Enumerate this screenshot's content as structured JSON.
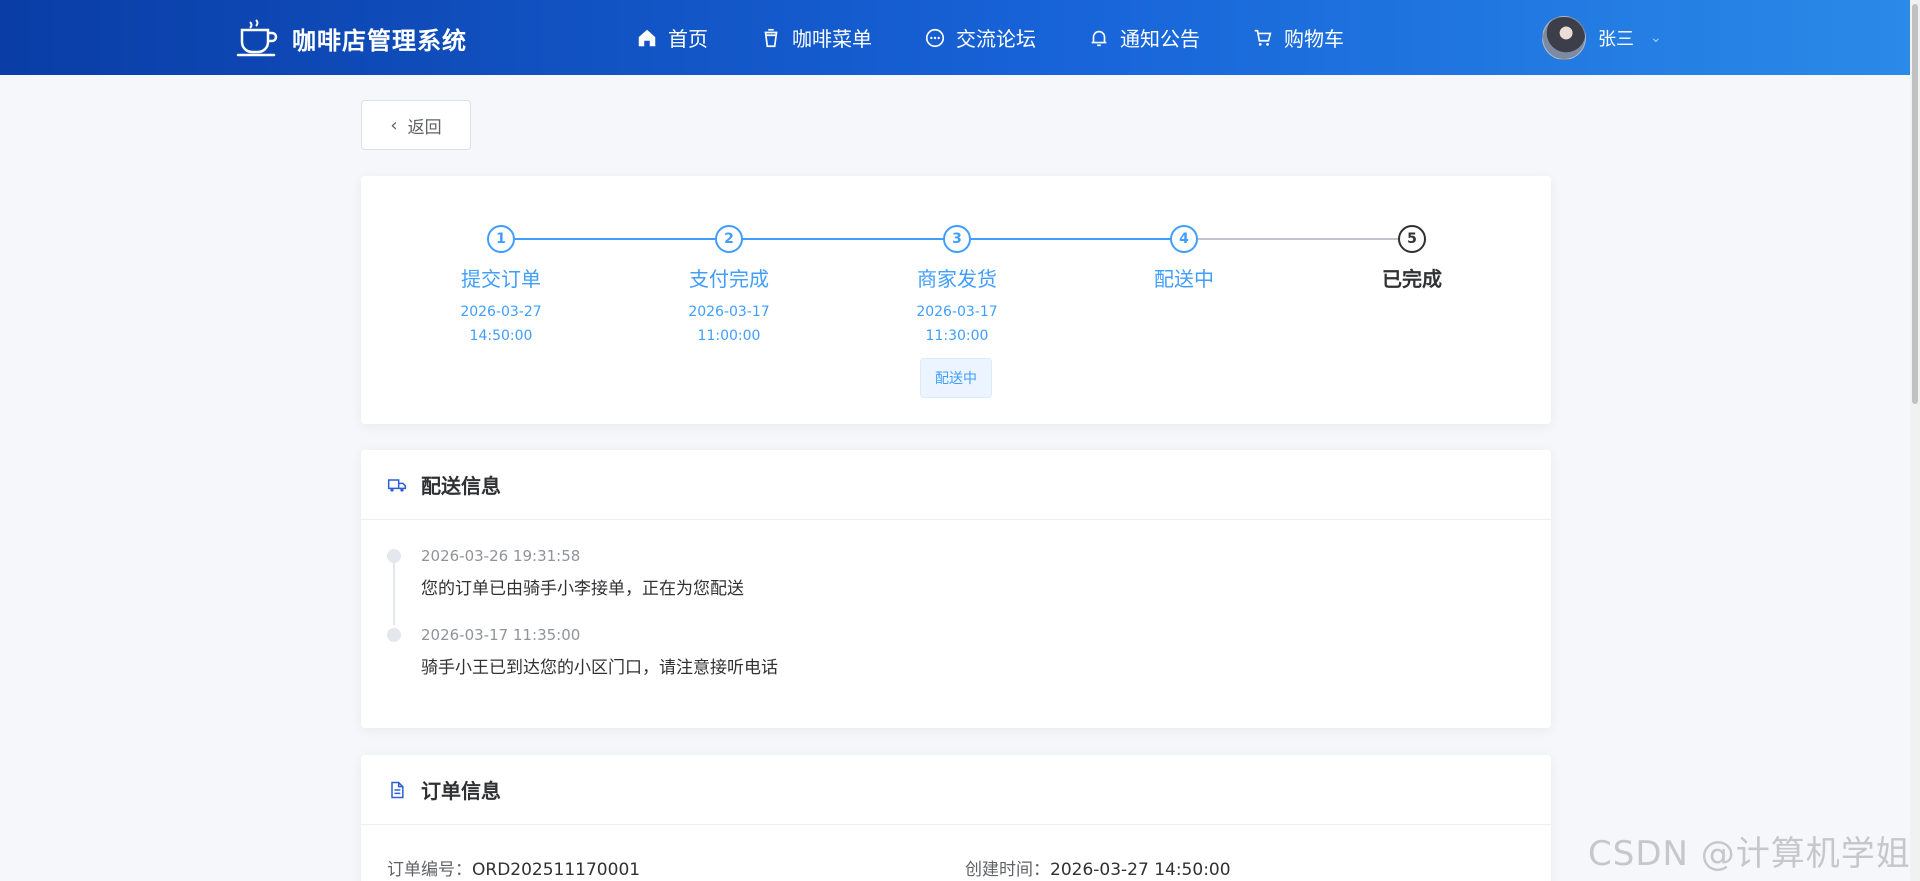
{
  "header": {
    "app_name": "咖啡店管理系统",
    "nav": [
      {
        "label": "首页",
        "icon": "home-icon"
      },
      {
        "label": "咖啡菜单",
        "icon": "cup-icon"
      },
      {
        "label": "交流论坛",
        "icon": "chat-icon"
      },
      {
        "label": "通知公告",
        "icon": "bell-icon"
      },
      {
        "label": "购物车",
        "icon": "cart-icon"
      }
    ],
    "user_name": "张三"
  },
  "back_label": "返回",
  "steps": [
    {
      "num": "1",
      "title": "提交订单",
      "date": "2026-03-27",
      "time": "14:50:00"
    },
    {
      "num": "2",
      "title": "支付完成",
      "date": "2026-03-17",
      "time": "11:00:00"
    },
    {
      "num": "3",
      "title": "商家发货",
      "date": "2026-03-17",
      "time": "11:30:00"
    },
    {
      "num": "4",
      "title": "配送中",
      "date": "",
      "time": ""
    },
    {
      "num": "5",
      "title": "已完成",
      "date": "",
      "time": ""
    }
  ],
  "status_tag": "配送中",
  "delivery": {
    "title": "配送信息",
    "events": [
      {
        "time": "2026-03-26 19:31:58",
        "text": "您的订单已由骑手小李接单，正在为您配送"
      },
      {
        "time": "2026-03-17 11:35:00",
        "text": "骑手小王已到达您的小区门口，请注意接听电话"
      }
    ]
  },
  "order": {
    "title": "订单信息",
    "number_label": "订单编号：",
    "number": "ORD202511170001",
    "created_label": "创建时间：",
    "created": "2026-03-27 14:50:00"
  },
  "watermark": "CSDN @计算机学姐",
  "colors": {
    "primary": "#409eff",
    "header_start": "#0a3da6",
    "header_end": "#2a8ae8"
  }
}
